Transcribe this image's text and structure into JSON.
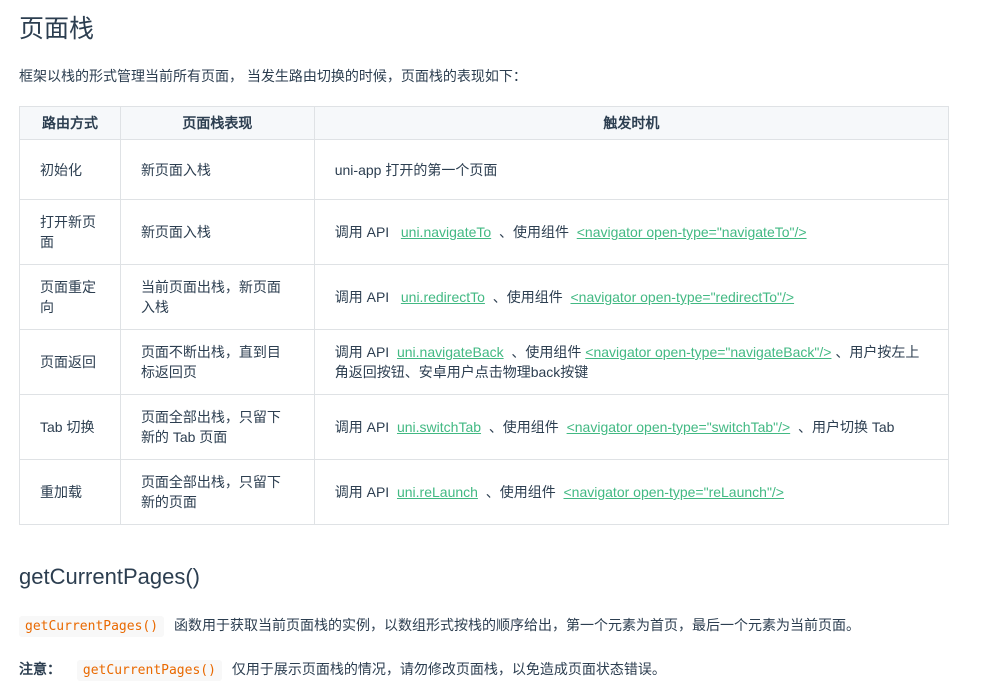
{
  "page": {
    "title": "页面栈",
    "intro": "框架以栈的形式管理当前所有页面， 当发生路由切换的时候，页面栈的表现如下："
  },
  "table": {
    "headers": [
      "路由方式",
      "页面栈表现",
      "触发时机"
    ],
    "rows": [
      {
        "route": "初始化",
        "behavior": "新页面入栈",
        "trigger_text": "uni-app 打开的第一个页面"
      },
      {
        "route": "打开新页面",
        "behavior": "新页面入栈",
        "prefix": "调用 API",
        "api": "uni.navigateTo",
        "mid": "、使用组件",
        "component": "<navigator open-type=\"navigateTo\"/>",
        "suffix": ""
      },
      {
        "route": "页面重定向",
        "behavior": "当前页面出栈，新页面入栈",
        "prefix": "调用 API",
        "api": "uni.redirectTo",
        "mid": "、使用组件",
        "component": "<navigator open-type=\"redirectTo\"/>",
        "suffix": ""
      },
      {
        "route": "页面返回",
        "behavior": "页面不断出栈，直到目标返回页",
        "prefix": "调用 API",
        "api": "uni.navigateBack",
        "mid": "、使用组件",
        "component": "<navigator open-type=\"navigateBack\"/>",
        "suffix": "、用户按左上角返回按钮、安卓用户点击物理back按键"
      },
      {
        "route": "Tab 切换",
        "behavior": "页面全部出栈，只留下新的 Tab 页面",
        "prefix": "调用 API",
        "api": "uni.switchTab",
        "mid": "、使用组件",
        "component": "<navigator open-type=\"switchTab\"/>",
        "suffix": "、用户切换 Tab"
      },
      {
        "route": "重加载",
        "behavior": "页面全部出栈，只留下新的页面",
        "prefix": "调用 API",
        "api": "uni.reLaunch",
        "mid": "、使用组件",
        "component": "<navigator open-type=\"reLaunch\"/>",
        "suffix": ""
      }
    ]
  },
  "section": {
    "title": "getCurrentPages()",
    "desc_code": "getCurrentPages()",
    "desc_text": "函数用于获取当前页面栈的实例，以数组形式按栈的顺序给出，第一个元素为首页，最后一个元素为当前页面。",
    "note_label": "注意：",
    "note_code": "getCurrentPages()",
    "note_text": "仅用于展示页面栈的情况，请勿修改页面栈，以免造成页面状态错误。"
  },
  "colors": {
    "link": "#42b983",
    "code": "#e96900",
    "text": "#2c3e50",
    "border": "#dfe2e5",
    "header_bg": "#f6f8fa"
  }
}
